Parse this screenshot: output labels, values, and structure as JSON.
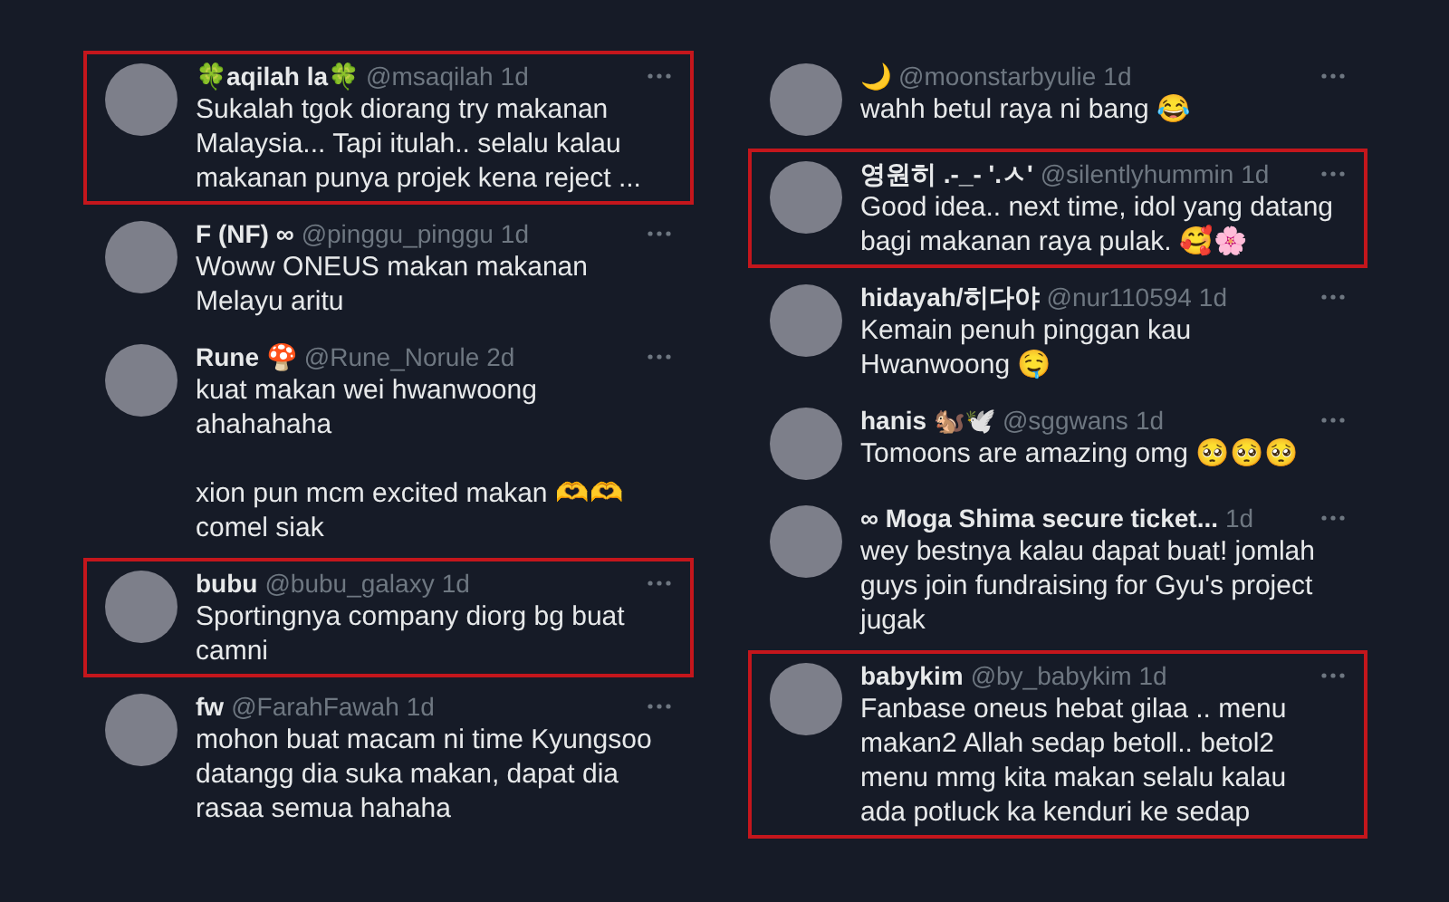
{
  "columns": [
    {
      "replies": [
        {
          "name": "🍀aqilah la🍀",
          "handle": "@msaqilah",
          "time": "1d",
          "text": "Sukalah tgok diorang try makanan Malaysia... Tapi itulah.. selalu kalau makanan punya projek kena reject ...",
          "highlighted": true
        },
        {
          "name": "F (NF) ∞",
          "handle": "@pinggu_pinggu",
          "time": "1d",
          "text": "Woww ONEUS makan makanan Melayu aritu",
          "highlighted": false
        },
        {
          "name": "Rune 🍄",
          "handle": "@Rune_Norule",
          "time": "2d",
          "text": "kuat makan wei hwanwoong ahahahaha\n\nxion pun mcm excited makan 🫶🫶 comel siak",
          "highlighted": false
        },
        {
          "name": "bubu",
          "handle": "@bubu_galaxy",
          "time": "1d",
          "text": "Sportingnya company diorg bg buat camni",
          "highlighted": true
        },
        {
          "name": "fw",
          "handle": "@FarahFawah",
          "time": "1d",
          "text": "mohon buat macam ni time Kyungsoo datangg dia suka makan, dapat dia rasaa semua hahaha",
          "highlighted": false
        }
      ]
    },
    {
      "replies": [
        {
          "name": "🌙",
          "handle": "@moonstarbyulie",
          "time": "1d",
          "text": "wahh betul raya ni bang 😂",
          "highlighted": false
        },
        {
          "name": "영원히 .-_- '.ㅅ'",
          "handle": "@silentlyhummin",
          "time": "1d",
          "text": "Good idea.. next time, idol yang datang bagi makanan raya pulak. 🥰🌸",
          "highlighted": true
        },
        {
          "name": "hidayah/히다야",
          "handle": "@nur110594",
          "time": "1d",
          "text": "Kemain penuh pinggan kau Hwanwoong 🤤",
          "highlighted": false
        },
        {
          "name": "hanis 🐿️🕊️",
          "handle": "@sggwans",
          "time": "1d",
          "text": "Tomoons are amazing omg 🥺🥺🥺",
          "highlighted": false
        },
        {
          "name": "∞ Moga Shima secure ticket...",
          "time": "1d",
          "text": "wey bestnya kalau dapat buat! jomlah guys join fundraising for Gyu's project jugak",
          "highlighted": false
        },
        {
          "name": "babykim",
          "handle": "@by_babykim",
          "time": "1d",
          "text": "Fanbase oneus hebat gilaa .. menu makan2 Allah sedap betoll.. betol2 menu mmg kita makan selalu kalau ada potluck ka kenduri ke sedap",
          "highlighted": true
        }
      ]
    }
  ]
}
